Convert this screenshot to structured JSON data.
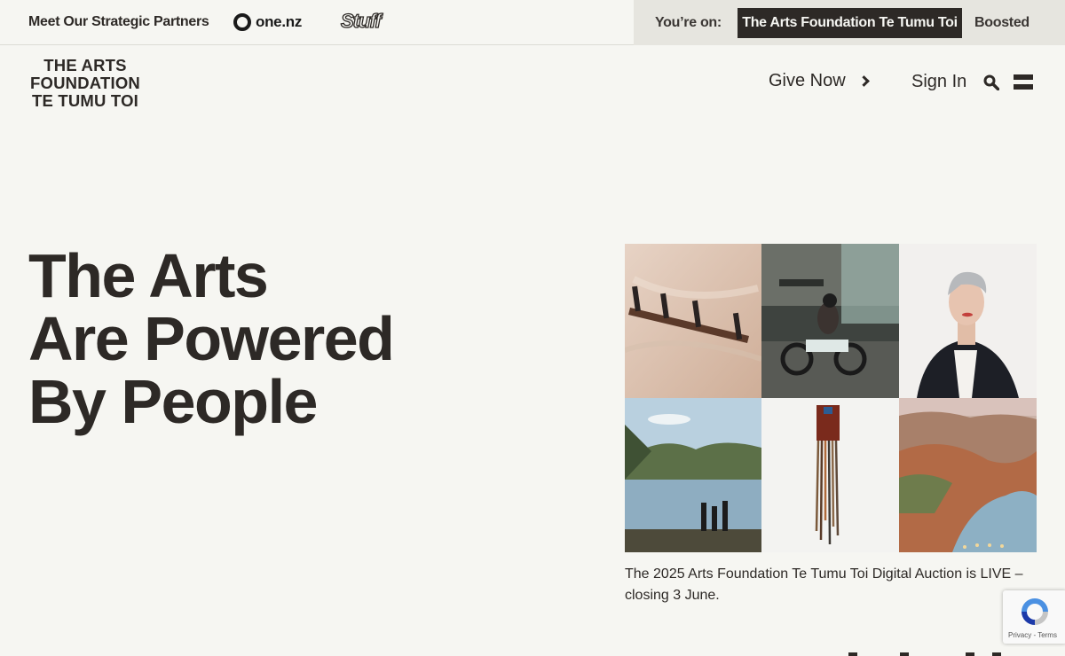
{
  "topbar": {
    "partners_label": "Meet Our Strategic Partners",
    "partner_onenz": "one.nz",
    "partner_stuff": "Stuff",
    "youre_on_label": "You’re on:",
    "site_active": "The Arts Foundation Te Tumu Toi",
    "site_other": "Boosted"
  },
  "header": {
    "logo_line1": "THE ARTS",
    "logo_line2": "FOUNDATION",
    "logo_line3": "TE TUMU TOI",
    "give_now": "Give Now",
    "sign_in": "Sign In",
    "icons": [
      "chevron-right-icon",
      "search-icon",
      "menu-icon"
    ]
  },
  "hero": {
    "title_line1": "The Arts",
    "title_line2": "Are Powered",
    "title_line3": "By People",
    "caption": "The 2025 Arts Foundation Te Tumu Toi Digital Auction is LIVE – closing 3 June.",
    "images": [
      "sculpture-hooks",
      "electric-motorbike",
      "portrait-woman",
      "lake-hikers",
      "woven-wall-hanging",
      "river-canyon"
    ]
  },
  "recaptcha": {
    "links": "Privacy - Terms"
  },
  "colors": {
    "background": "#f6f6f2",
    "text": "#2d2926",
    "switch_bg": "#e6e5df",
    "active_site_bg": "#2d2926"
  }
}
